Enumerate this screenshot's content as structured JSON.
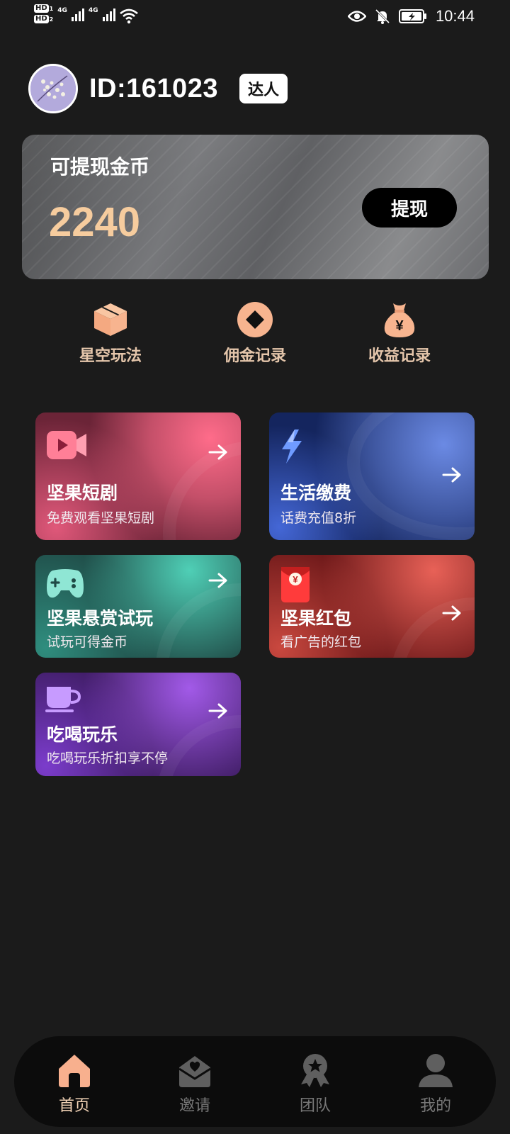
{
  "status_bar": {
    "hd1": "HD",
    "hd1_sub": "1",
    "hd2": "HD",
    "hd2_sub": "2",
    "net1": "4G",
    "net2": "4G",
    "time": "10:44"
  },
  "profile": {
    "id_text": "ID:161023",
    "badge": "达人"
  },
  "balance": {
    "label": "可提现金币",
    "value": "2240",
    "withdraw_button": "提现"
  },
  "quick_actions": [
    {
      "label": "星空玩法",
      "icon": "box-icon"
    },
    {
      "label": "佣金记录",
      "icon": "diamond-icon"
    },
    {
      "label": "收益记录",
      "icon": "money-bag-icon"
    }
  ],
  "features": [
    {
      "title": "坚果短剧",
      "subtitle": "免费观看坚果短剧",
      "icon": "video-camera-icon",
      "color": "#ff6c8a"
    },
    {
      "title": "生活缴费",
      "subtitle": "话费充值8折",
      "icon": "lightning-icon",
      "color": "#6b8ae4"
    },
    {
      "title": "坚果悬赏试玩",
      "subtitle": "试玩可得金币",
      "icon": "gamepad-icon",
      "color": "#4fcfb6"
    },
    {
      "title": "坚果红包",
      "subtitle": "看广告的红包",
      "icon": "red-envelope-icon",
      "color": "#e86157"
    },
    {
      "title": "吃喝玩乐",
      "subtitle": "吃喝玩乐折扣享不停",
      "icon": "cup-icon",
      "color": "#a25ae8"
    }
  ],
  "tabs": [
    {
      "label": "首页",
      "icon": "home-icon",
      "active": true
    },
    {
      "label": "邀请",
      "icon": "invite-envelope-icon",
      "active": false
    },
    {
      "label": "团队",
      "icon": "team-medal-icon",
      "active": false
    },
    {
      "label": "我的",
      "icon": "profile-person-icon",
      "active": false
    }
  ],
  "colors": {
    "accent": "#f6cc9e",
    "quick_icon": "#f7b48f",
    "background": "#1b1b1b"
  }
}
